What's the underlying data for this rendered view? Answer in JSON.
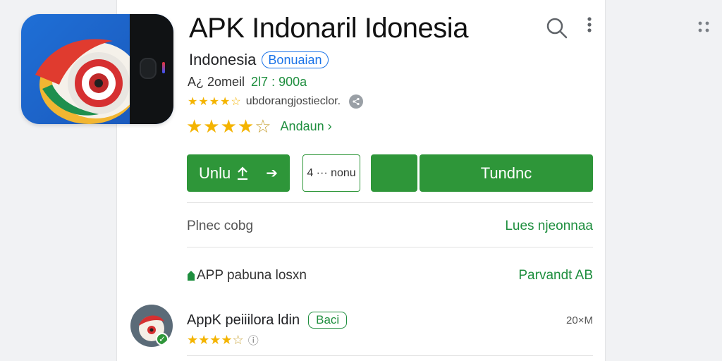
{
  "app": {
    "title": "APK Indonaril Idonesia",
    "developer": "Indonesia",
    "developer_chip": "Bonuaian",
    "meta_prefix": "A¿ 2omeil",
    "meta_version": "2l7 : 900a",
    "rating_text": "ubdorangjostieclor.",
    "share_icon": "share-icon",
    "stars_small": "★★★★☆",
    "stars_large": "★★★★",
    "stars_large_empty": "☆",
    "reviews_link": "Andaun",
    "reviews_chevron": "›"
  },
  "buttons": {
    "primary_label": "Unlu",
    "primary_icon": "➔",
    "outline_label": "4 ··· nonu",
    "install_label": "Tundnc"
  },
  "info": {
    "row1_left": "Plnec cobg",
    "row1_right": "Lues njeonnaa",
    "row2_left": "APP pabuna losxn",
    "row2_right": "Parvandt AB"
  },
  "related": {
    "title": "AppK peiiilora ldin",
    "badge": "Baci",
    "size": "20×M",
    "stars": "★★★★",
    "stars_empty": "☆",
    "info_icon": "ⓘ"
  },
  "icons": {
    "search": "search-icon",
    "more": "more-vert-icon",
    "grid": "grid-dots-icon"
  },
  "colors": {
    "accent_green": "#2e9639",
    "link_green": "#1e8e3e",
    "link_blue": "#1a73e8",
    "star": "#f4b400"
  }
}
